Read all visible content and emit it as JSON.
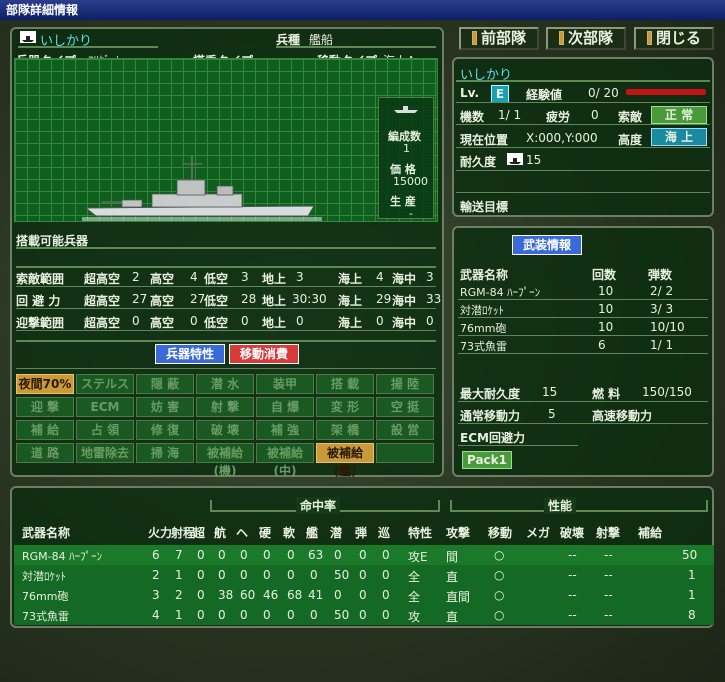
{
  "window": {
    "title": "部隊詳細情報"
  },
  "nav": {
    "prev": "前部隊",
    "next": "次部隊",
    "close": "閉じる"
  },
  "unit": {
    "name": "いしかり",
    "kind_label": "兵種",
    "kind": "艦船",
    "weapon_type_label": "兵器タイプ",
    "weapon_type": "ﾌﾘｹﾞｰﾄ",
    "boarding_type_label": "搭乗タイプ",
    "move_type_label": "移動タイプ",
    "move_type": "海上A",
    "formation_label": "編成数",
    "formation": "1",
    "price_label": "価 格",
    "price": "15000",
    "production_label": "生 産",
    "production": "-"
  },
  "loadable": {
    "label": "搭載可能兵器"
  },
  "ranges": {
    "rows": [
      {
        "label": "索敵範囲",
        "vals": [
          [
            "超高空",
            "2"
          ],
          [
            "高空",
            "4"
          ],
          [
            "低空",
            "3"
          ],
          [
            "地上",
            "3"
          ],
          [
            "海上",
            "4"
          ],
          [
            "海中",
            "3"
          ]
        ]
      },
      {
        "label": "回 避 力",
        "vals": [
          [
            "超高空",
            "27"
          ],
          [
            "高空",
            "27"
          ],
          [
            "低空",
            "28"
          ],
          [
            "地上",
            "30:30"
          ],
          [
            "海上",
            "29"
          ],
          [
            "海中",
            "33"
          ]
        ]
      },
      {
        "label": "迎撃範囲",
        "vals": [
          [
            "超高空",
            "0"
          ],
          [
            "高空",
            "0"
          ],
          [
            "低空",
            "0"
          ],
          [
            "地上",
            "0"
          ],
          [
            "海上",
            "0"
          ],
          [
            "海中",
            "0"
          ]
        ]
      }
    ]
  },
  "tabs": {
    "traits": "兵器特性",
    "move_cost": "移動消費"
  },
  "traits": {
    "rows": [
      [
        "夜間70%",
        "ステルス",
        "隠 蔽",
        "潜 水",
        "装甲",
        "搭 載",
        "揚 陸"
      ],
      [
        "迎 撃",
        "ECM",
        "妨 害",
        "射 撃",
        "自 爆",
        "変 形",
        "空 挺"
      ],
      [
        "補 給",
        "占 領",
        "修 復",
        "破 壊",
        "補 強",
        "架 橋",
        "設 営"
      ],
      [
        "道 路",
        "地雷除去",
        "掃 海",
        "被補給(機)",
        "被補給(中)",
        "被補給(艦)",
        ""
      ]
    ]
  },
  "status": {
    "name": "いしかり",
    "lv_label": "Lv.",
    "lv": "E",
    "exp_label": "経験値",
    "exp": "0/ 20",
    "exp_fraction": 0.0,
    "units_label": "機数",
    "units": "1/ 1",
    "fatigue_label": "疲労",
    "fatigue": "0",
    "search_label": "索敵",
    "search": "正 常",
    "pos_label": "現在位置",
    "pos": "X:000,Y:000",
    "alt_label": "高度",
    "alt": "海 上",
    "durability_label": "耐久度",
    "durability": "15",
    "transport_label": "輸送目標"
  },
  "armament": {
    "title": "武装情報",
    "headers": [
      "武器名称",
      "回数",
      "弾数"
    ],
    "rows": [
      [
        "RGM-84 ﾊｰﾌﾟｰﾝ",
        "10",
        "2/ 2"
      ],
      [
        "対潜ﾛｹｯﾄ",
        "10",
        "3/ 3"
      ],
      [
        "76mm砲",
        "10",
        "10/10"
      ],
      [
        "73式魚雷",
        "6",
        "1/ 1"
      ]
    ]
  },
  "specs": {
    "max_dur_label": "最大耐久度",
    "max_dur": "15",
    "fuel_label": "燃 料",
    "fuel": "150/150",
    "move_label": "通常移動力",
    "move": "5",
    "fast_move_label": "高速移動力",
    "ecm_label": "ECM回避力",
    "pack": "Pack1"
  },
  "weapons_table": {
    "group_accuracy": "命中率",
    "group_perf": "性能",
    "headers": [
      "武器名称",
      "火力",
      "射程",
      "超",
      "航",
      "ヘ",
      "硬",
      "軟",
      "艦",
      "潜",
      "弾",
      "巡",
      "特性",
      "攻撃",
      "移動",
      "メガ",
      "破壊",
      "射撃",
      "補給"
    ],
    "rows": [
      [
        "RGM-84 ﾊｰﾌﾟｰﾝ",
        "6",
        "7",
        "0",
        "0",
        "0",
        "0",
        "0",
        "63",
        "0",
        "0",
        "0",
        "攻E",
        "間",
        "○",
        "",
        "--",
        "--",
        "50"
      ],
      [
        "対潜ﾛｹｯﾄ",
        "2",
        "1",
        "0",
        "0",
        "0",
        "0",
        "0",
        "0",
        "50",
        "0",
        "0",
        "全",
        "直",
        "○",
        "",
        "--",
        "--",
        "1"
      ],
      [
        "76mm砲",
        "3",
        "2",
        "0",
        "38",
        "60",
        "46",
        "68",
        "41",
        "0",
        "0",
        "0",
        "全",
        "直間",
        "○",
        "",
        "--",
        "--",
        "1"
      ],
      [
        "73式魚雷",
        "4",
        "1",
        "0",
        "0",
        "0",
        "0",
        "0",
        "0",
        "50",
        "0",
        "0",
        "攻",
        "直",
        "○",
        "",
        "--",
        "--",
        "8"
      ]
    ]
  },
  "colors": {
    "accent_blue": "#3a6ad8",
    "accent_red": "#d83a3a",
    "active_gold": "#c89a3a"
  }
}
